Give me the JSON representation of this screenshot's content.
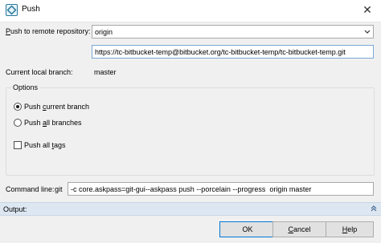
{
  "window": {
    "title": "Push",
    "icon": "git-gui-icon",
    "close_glyph": "✕"
  },
  "remote": {
    "label_prefix": "",
    "label_mnemonic": "P",
    "label_rest": "ush to remote repository:",
    "selected": "origin",
    "url": "https://tc-bitbucket-temp@bitbucket.org/tc-bitbucket-temp/tc-bitbucket-temp.git"
  },
  "branch": {
    "label": "Current local branch:",
    "value": "master"
  },
  "options": {
    "title": "Options",
    "push_current": {
      "pre": "Push ",
      "mnemonic": "c",
      "post": "urrent branch",
      "checked": true
    },
    "push_all": {
      "pre": "Push ",
      "mnemonic": "a",
      "post": "ll branches",
      "checked": false
    },
    "push_tags": {
      "pre": "Push all ",
      "mnemonic": "t",
      "post": "ags",
      "checked": false
    }
  },
  "command": {
    "label": "Command line:",
    "program": "git",
    "value": "-c core.askpass=git-gui--askpass push --porcelain --progress  origin master"
  },
  "output": {
    "label": "Output:",
    "toggle_icon": "double-chevron-up-icon"
  },
  "buttons": {
    "ok": "OK",
    "cancel": {
      "pre": "",
      "mnemonic": "C",
      "post": "ancel"
    },
    "help": {
      "pre": "",
      "mnemonic": "H",
      "post": "elp"
    }
  },
  "colors": {
    "accent": "#0078d7",
    "output_bar": "#dde7f2",
    "dialog_bg": "#f0f0f0"
  }
}
